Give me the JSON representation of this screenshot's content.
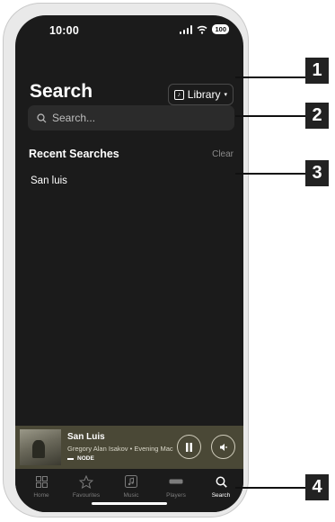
{
  "status_bar": {
    "time": "10:00",
    "battery": "100"
  },
  "header": {
    "title": "Search",
    "library_label": "Library"
  },
  "search": {
    "placeholder": "Search..."
  },
  "recent": {
    "header": "Recent Searches",
    "clear_label": "Clear",
    "items": [
      "San luis"
    ]
  },
  "now_playing": {
    "title": "San Luis",
    "subtitle": "Gregory Alan Isakov • Evening Machi",
    "device": "NODE"
  },
  "tabs": [
    {
      "label": "Home",
      "icon": "home-icon",
      "active": false
    },
    {
      "label": "Favourites",
      "icon": "star-icon",
      "active": false
    },
    {
      "label": "Music",
      "icon": "music-note-icon",
      "active": false
    },
    {
      "label": "Players",
      "icon": "speaker-icon",
      "active": false
    },
    {
      "label": "Search",
      "icon": "search-icon",
      "active": true
    }
  ],
  "callouts": [
    "1",
    "2",
    "3",
    "4"
  ],
  "colors": {
    "background": "#1b1b1b",
    "miniplayer": "#4a4836",
    "accent": "#ffffff"
  }
}
